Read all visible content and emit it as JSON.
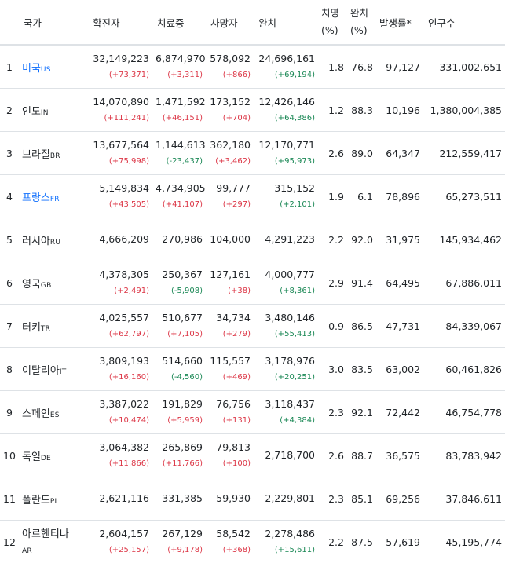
{
  "headers": [
    "국가",
    "확진자",
    "치료중",
    "사망자",
    "완치",
    "치명",
    "(%)",
    "완치",
    "(%)",
    "발생률*",
    "인구수"
  ],
  "rows": [
    {
      "rank": "1",
      "name": "미국",
      "code": "US",
      "link": true,
      "confirmed": "32,149,223",
      "confirmed_d": "(+73,371)",
      "active": "6,874,970",
      "active_d": "(+3,311)",
      "active_dir": "up",
      "deaths": "578,092",
      "deaths_d": "(+866)",
      "recovered": "24,696,161",
      "recovered_d": "(+69,194)",
      "fatality": "1.8",
      "recovery": "76.8",
      "incidence": "97,127",
      "population": "331,002,651"
    },
    {
      "rank": "2",
      "name": "인도",
      "code": "IN",
      "link": false,
      "confirmed": "14,070,890",
      "confirmed_d": "(+111,241)",
      "active": "1,471,592",
      "active_d": "(+46,151)",
      "active_dir": "up",
      "deaths": "173,152",
      "deaths_d": "(+704)",
      "recovered": "12,426,146",
      "recovered_d": "(+64,386)",
      "fatality": "1.2",
      "recovery": "88.3",
      "incidence": "10,196",
      "population": "1,380,004,385"
    },
    {
      "rank": "3",
      "name": "브라질",
      "code": "BR",
      "link": false,
      "confirmed": "13,677,564",
      "confirmed_d": "(+75,998)",
      "active": "1,144,613",
      "active_d": "(-23,437)",
      "active_dir": "down",
      "deaths": "362,180",
      "deaths_d": "(+3,462)",
      "recovered": "12,170,771",
      "recovered_d": "(+95,973)",
      "fatality": "2.6",
      "recovery": "89.0",
      "incidence": "64,347",
      "population": "212,559,417"
    },
    {
      "rank": "4",
      "name": "프랑스",
      "code": "FR",
      "link": true,
      "confirmed": "5,149,834",
      "confirmed_d": "(+43,505)",
      "active": "4,734,905",
      "active_d": "(+41,107)",
      "active_dir": "up",
      "deaths": "99,777",
      "deaths_d": "(+297)",
      "recovered": "315,152",
      "recovered_d": "(+2,101)",
      "fatality": "1.9",
      "recovery": "6.1",
      "incidence": "78,896",
      "population": "65,273,511"
    },
    {
      "rank": "5",
      "name": "러시아",
      "code": "RU",
      "link": false,
      "confirmed": "4,666,209",
      "confirmed_d": "",
      "active": "270,986",
      "active_d": "",
      "active_dir": "",
      "deaths": "104,000",
      "deaths_d": "",
      "recovered": "4,291,223",
      "recovered_d": "",
      "fatality": "2.2",
      "recovery": "92.0",
      "incidence": "31,975",
      "population": "145,934,462"
    },
    {
      "rank": "6",
      "name": "영국",
      "code": "GB",
      "link": false,
      "confirmed": "4,378,305",
      "confirmed_d": "(+2,491)",
      "active": "250,367",
      "active_d": "(-5,908)",
      "active_dir": "down",
      "deaths": "127,161",
      "deaths_d": "(+38)",
      "recovered": "4,000,777",
      "recovered_d": "(+8,361)",
      "fatality": "2.9",
      "recovery": "91.4",
      "incidence": "64,495",
      "population": "67,886,011"
    },
    {
      "rank": "7",
      "name": "터키",
      "code": "TR",
      "link": false,
      "confirmed": "4,025,557",
      "confirmed_d": "(+62,797)",
      "active": "510,677",
      "active_d": "(+7,105)",
      "active_dir": "up",
      "deaths": "34,734",
      "deaths_d": "(+279)",
      "recovered": "3,480,146",
      "recovered_d": "(+55,413)",
      "fatality": "0.9",
      "recovery": "86.5",
      "incidence": "47,731",
      "population": "84,339,067"
    },
    {
      "rank": "8",
      "name": "이탈리아",
      "code": "IT",
      "link": false,
      "confirmed": "3,809,193",
      "confirmed_d": "(+16,160)",
      "active": "514,660",
      "active_d": "(-4,560)",
      "active_dir": "down",
      "deaths": "115,557",
      "deaths_d": "(+469)",
      "recovered": "3,178,976",
      "recovered_d": "(+20,251)",
      "fatality": "3.0",
      "recovery": "83.5",
      "incidence": "63,002",
      "population": "60,461,826"
    },
    {
      "rank": "9",
      "name": "스페인",
      "code": "ES",
      "link": false,
      "confirmed": "3,387,022",
      "confirmed_d": "(+10,474)",
      "active": "191,829",
      "active_d": "(+5,959)",
      "active_dir": "up",
      "deaths": "76,756",
      "deaths_d": "(+131)",
      "recovered": "3,118,437",
      "recovered_d": "(+4,384)",
      "fatality": "2.3",
      "recovery": "92.1",
      "incidence": "72,442",
      "population": "46,754,778"
    },
    {
      "rank": "10",
      "name": "독일",
      "code": "DE",
      "link": false,
      "confirmed": "3,064,382",
      "confirmed_d": "(+11,866)",
      "active": "265,869",
      "active_d": "(+11,766)",
      "active_dir": "up",
      "deaths": "79,813",
      "deaths_d": "(+100)",
      "recovered": "2,718,700",
      "recovered_d": "",
      "fatality": "2.6",
      "recovery": "88.7",
      "incidence": "36,575",
      "population": "83,783,942"
    },
    {
      "rank": "11",
      "name": "폴란드",
      "code": "PL",
      "link": false,
      "confirmed": "2,621,116",
      "confirmed_d": "",
      "active": "331,385",
      "active_d": "",
      "active_dir": "",
      "deaths": "59,930",
      "deaths_d": "",
      "recovered": "2,229,801",
      "recovered_d": "",
      "fatality": "2.3",
      "recovery": "85.1",
      "incidence": "69,256",
      "population": "37,846,611"
    },
    {
      "rank": "12",
      "name": "아르헨티나",
      "code": "AR",
      "link": false,
      "confirmed": "2,604,157",
      "confirmed_d": "(+25,157)",
      "active": "267,129",
      "active_d": "(+9,178)",
      "active_dir": "up",
      "deaths": "58,542",
      "deaths_d": "(+368)",
      "recovered": "2,278,486",
      "recovered_d": "(+15,611)",
      "fatality": "2.2",
      "recovery": "87.5",
      "incidence": "57,619",
      "population": "45,195,774"
    }
  ],
  "colors": {
    "link": "#0d6efd",
    "increase": "#dc3545",
    "decrease": "#198754",
    "border": "#dee2e6"
  }
}
